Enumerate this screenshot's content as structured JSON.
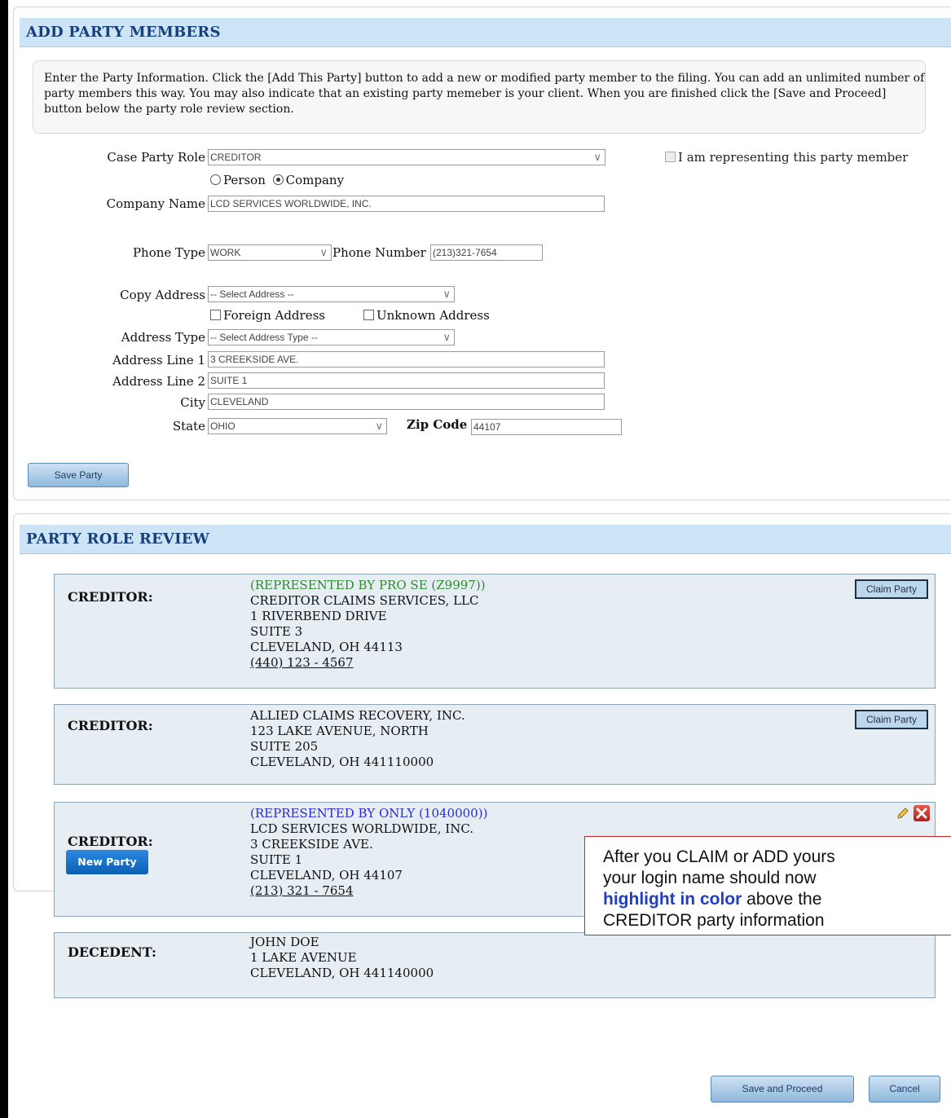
{
  "add_section": {
    "title": "ADD PARTY MEMBERS",
    "instructions": "Enter the Party Information. Click the [Add This Party] button to add a new or modified party member to the filing. You can add an unlimited number of party members this way. You may also indicate that an existing party memeber is your client. When you are finished click the [Save and Proceed] button below the party role review section."
  },
  "form": {
    "case_party_role_label": "Case Party Role",
    "case_party_role_value": "CREDITOR",
    "representing_label": "I am representing this party member",
    "person_label": "Person",
    "company_label": "Company",
    "company_name_label": "Company Name",
    "company_name_value": "LCD SERVICES WORLDWIDE, INC.",
    "phone_type_label": "Phone Type",
    "phone_type_value": "WORK",
    "phone_number_label": "Phone Number",
    "phone_number_value": "(213)321-7654",
    "copy_address_label": "Copy Address",
    "copy_address_value": "-- Select Address --",
    "foreign_address_label": "Foreign Address",
    "unknown_address_label": "Unknown Address",
    "address_type_label": "Address Type",
    "address_type_value": "-- Select Address Type --",
    "address_line1_label": "Address Line 1",
    "address_line1_value": "3 CREEKSIDE AVE.",
    "address_line2_label": "Address Line 2",
    "address_line2_value": "SUITE 1",
    "city_label": "City",
    "city_value": "CLEVELAND",
    "state_label": "State",
    "state_value": "OHIO",
    "zip_label": "Zip Code",
    "zip_value": "44107",
    "save_party_label": "Save Party"
  },
  "review": {
    "title": "PARTY ROLE REVIEW",
    "claim_label": "Claim Party",
    "new_party_label": "New Party",
    "parties": [
      {
        "role": "CREDITOR:",
        "rep": "(REPRESENTED BY PRO SE (Z9997))",
        "rep_color": "#2e8b2e",
        "name": "CREDITOR CLAIMS SERVICES, LLC",
        "line1": "1 RIVERBEND DRIVE",
        "line2": "SUITE 3",
        "city": "CLEVELAND, OH 44113",
        "phone": "(440) 123 - 4567"
      },
      {
        "role": "CREDITOR:",
        "name": "ALLIED CLAIMS RECOVERY, INC.",
        "line1": "123 LAKE AVENUE, NORTH",
        "line2": "SUITE 205",
        "city": "CLEVELAND, OH 441110000"
      },
      {
        "role": "CREDITOR:",
        "rep": "(REPRESENTED BY ONLY (1040000))",
        "rep_color": "#2a2ad8",
        "name": "LCD SERVICES WORLDWIDE, INC.",
        "line1": "3 CREEKSIDE AVE.",
        "line2": "SUITE 1",
        "city": "CLEVELAND, OH 44107",
        "phone": "(213) 321 - 7654"
      },
      {
        "role": "DECEDENT:",
        "name": "JOHN DOE",
        "line1": "1 LAKE AVENUE",
        "city": "CLEVELAND, OH 441140000"
      }
    ]
  },
  "callout": {
    "line1": "After you CLAIM or ADD yours",
    "line2": "your login name should now",
    "highlight": "highlight in color",
    "line3_rest": " above the",
    "line4": "CREDITOR party information",
    "highlight_color": "#1f3fbf",
    "border_color": "#d12525"
  },
  "footer": {
    "save_proceed_label": "Save and Proceed",
    "cancel_label": "Cancel"
  }
}
